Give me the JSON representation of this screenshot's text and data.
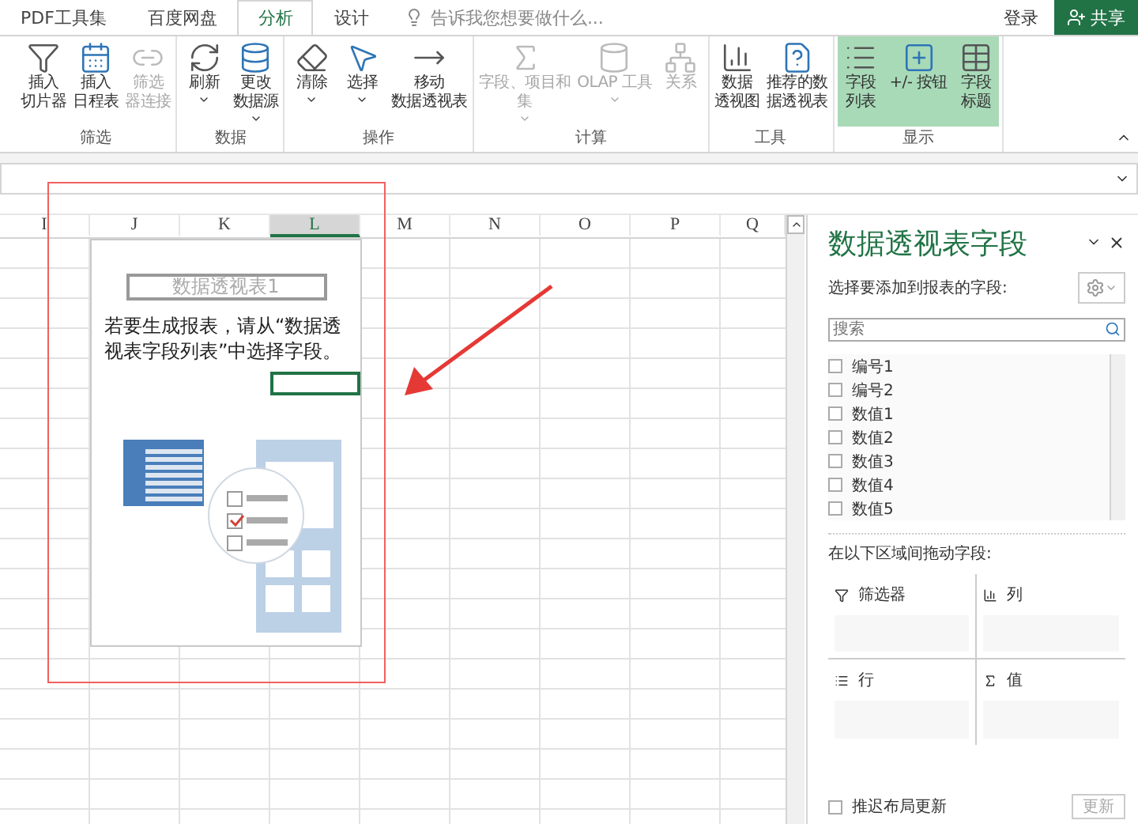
{
  "ribbon_tabs": [
    {
      "label": "PDF工具集",
      "selected": false
    },
    {
      "label": "百度网盘",
      "selected": false
    },
    {
      "label": "分析",
      "selected": true
    },
    {
      "label": "设计",
      "selected": false
    }
  ],
  "tell_me": {
    "placeholder": "告诉我您想要做什么..."
  },
  "account": {
    "sign_in": "登录",
    "share": "共享"
  },
  "ribbon_groups": [
    {
      "label": "筛选",
      "buttons": [
        {
          "lines": [
            "插入",
            "切片器"
          ],
          "disabled": false,
          "dropdown": false,
          "selected": false
        },
        {
          "lines": [
            "插入",
            "日程表"
          ],
          "disabled": false,
          "dropdown": false,
          "selected": false
        },
        {
          "lines": [
            "筛选",
            "器连接"
          ],
          "disabled": true,
          "dropdown": false,
          "selected": false
        }
      ]
    },
    {
      "label": "数据",
      "buttons": [
        {
          "lines": [
            "刷新"
          ],
          "disabled": false,
          "dropdown": true,
          "selected": false
        },
        {
          "lines": [
            "更改",
            "数据源"
          ],
          "disabled": false,
          "dropdown": true,
          "selected": false
        }
      ]
    },
    {
      "label": "操作",
      "buttons": [
        {
          "lines": [
            "清除"
          ],
          "disabled": false,
          "dropdown": true,
          "selected": false
        },
        {
          "lines": [
            "选择"
          ],
          "disabled": false,
          "dropdown": true,
          "selected": false
        },
        {
          "lines": [
            "移动",
            "数据透视表"
          ],
          "disabled": false,
          "dropdown": false,
          "selected": false
        }
      ]
    },
    {
      "label": "计算",
      "buttons": [
        {
          "lines": [
            "字段、项目和",
            "集"
          ],
          "disabled": true,
          "dropdown": true,
          "selected": false
        },
        {
          "lines": [
            "OLAP 工具"
          ],
          "disabled": true,
          "dropdown": true,
          "selected": false
        },
        {
          "lines": [
            "关系"
          ],
          "disabled": true,
          "dropdown": false,
          "selected": false
        }
      ]
    },
    {
      "label": "工具",
      "buttons": [
        {
          "lines": [
            "数据",
            "透视图"
          ],
          "disabled": false,
          "dropdown": false,
          "selected": false
        },
        {
          "lines": [
            "推荐的数",
            "据透视表"
          ],
          "disabled": false,
          "dropdown": false,
          "selected": false
        }
      ]
    },
    {
      "label": "显示",
      "buttons": [
        {
          "lines": [
            "字段",
            "列表"
          ],
          "disabled": false,
          "dropdown": false,
          "selected": true
        },
        {
          "lines": [
            "+/- 按钮"
          ],
          "disabled": false,
          "dropdown": false,
          "selected": true
        },
        {
          "lines": [
            "字段",
            "标题"
          ],
          "disabled": false,
          "dropdown": false,
          "selected": true
        }
      ]
    }
  ],
  "sheet": {
    "columns": [
      {
        "label": "I",
        "selected": false
      },
      {
        "label": "J",
        "selected": false
      },
      {
        "label": "K",
        "selected": false
      },
      {
        "label": "L",
        "selected": true
      },
      {
        "label": "M",
        "selected": false
      },
      {
        "label": "N",
        "selected": false
      },
      {
        "label": "O",
        "selected": false
      },
      {
        "label": "P",
        "selected": false
      },
      {
        "label": "Q",
        "selected": false
      }
    ],
    "pivot_placeholder": {
      "title": "数据透视表1",
      "instruction": "若要生成报表，请从“数据透视表字段列表”中选择字段。"
    }
  },
  "field_pane": {
    "title": "数据透视表字段",
    "prompt": "选择要添加到报表的字段:",
    "search": {
      "placeholder": "搜索"
    },
    "fields": [
      {
        "name": "编号1",
        "checked": false
      },
      {
        "name": "编号2",
        "checked": false
      },
      {
        "name": "数值1",
        "checked": false
      },
      {
        "name": "数值2",
        "checked": false
      },
      {
        "name": "数值3",
        "checked": false
      },
      {
        "name": "数值4",
        "checked": false
      },
      {
        "name": "数值5",
        "checked": false
      }
    ],
    "areas_prompt": "在以下区域间拖动字段:",
    "areas": [
      {
        "kind": "filters",
        "label": "筛选器"
      },
      {
        "kind": "columns",
        "label": "列"
      },
      {
        "kind": "rows",
        "label": "行"
      },
      {
        "kind": "values",
        "label": "值"
      }
    ],
    "defer": {
      "label": "推迟布局更新",
      "checked": false
    },
    "update_button": "更新"
  }
}
